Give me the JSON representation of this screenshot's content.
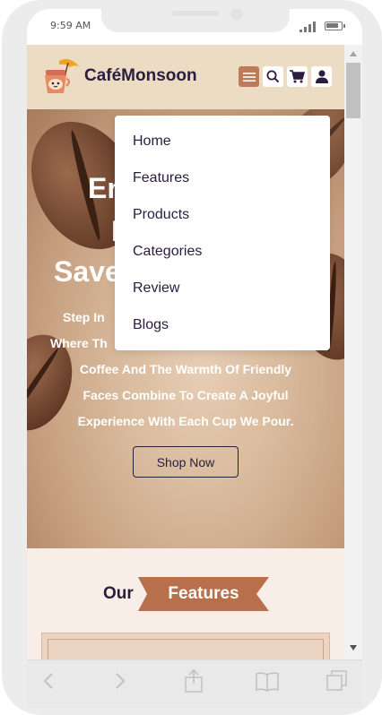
{
  "status_bar": {
    "time": "9:59 AM"
  },
  "header": {
    "brand": "CaféMonsoon",
    "icons": [
      "menu-icon",
      "search-icon",
      "cart-icon",
      "user-icon"
    ]
  },
  "hero": {
    "title_line1": "En",
    "title_line2": "N",
    "title_line3": "Save",
    "text_lines": [
      "Step In",
      "Where Th",
      "Coffee And The Warmth Of Friendly",
      "Faces Combine To Create A Joyful",
      "Experience With Each Cup We Pour."
    ],
    "shop_button": "Shop Now"
  },
  "nav_menu": {
    "items": [
      "Home",
      "Features",
      "Products",
      "Categories",
      "Review",
      "Blogs"
    ]
  },
  "features": {
    "heading_prefix": "Our",
    "heading_label": "Features"
  },
  "colors": {
    "brand_dark": "#2a1d3d",
    "accent": "#bf7a56",
    "header_bg": "#ecdcc3",
    "ribbon": "#b8704c"
  },
  "browser_toolbar": {
    "icons": [
      "back-icon",
      "forward-icon",
      "share-icon",
      "bookmarks-icon",
      "tabs-icon"
    ]
  }
}
